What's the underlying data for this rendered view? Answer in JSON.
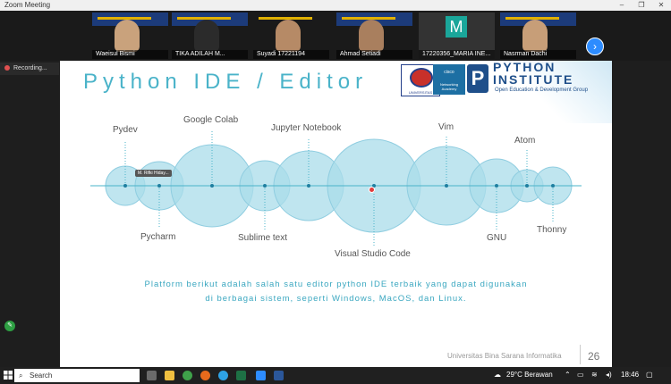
{
  "window": {
    "title": "Zoom Meeting"
  },
  "participants": [
    {
      "name": "Waeisul Bismi"
    },
    {
      "name": "TIKA ADILAH M..."
    },
    {
      "name": "Suyadi 17221194"
    },
    {
      "name": "Ahmad Setiadi"
    },
    {
      "name": "17220356_MARIA INE...",
      "avatar_letter": "M"
    },
    {
      "name": "Nasrman Dachi"
    }
  ],
  "recording": {
    "label": "Recording..."
  },
  "slide": {
    "title": "Python IDE / Editor",
    "logo_univ": "UNIVERSITAS",
    "logo_cisco": "cisco",
    "logo_academy": "Networking Academy",
    "python_institute_letter": "P",
    "python_institute_name_line1": "PYTHON",
    "python_institute_name_line2": "INSTITUTE",
    "python_institute_sub": "Open Education & Development Group",
    "ide_labels": {
      "pydev": "Pydev",
      "pycharm": "Pycharm",
      "colab": "Google Colab",
      "sublime": "Sublime text",
      "jupyter": "Jupyter Notebook",
      "vscode": "Visual Studio Code",
      "vim": "Vim",
      "gnu": "GNU",
      "atom": "Atom",
      "thonny": "Thonny"
    },
    "tooltip": "M. Rifki Hiday...",
    "caption_line1": "Platform berikut adalah salah satu editor python IDE terbaik yang dapat digunakan",
    "caption_line2": "di berbagai sistem, seperti Windows, MacOS, dan Linux.",
    "footer": "Universitas Bina Sarana Informatika",
    "page_number": "26"
  },
  "taskbar": {
    "search_placeholder": "Search",
    "weather": "29°C  Berawan",
    "time": "18:46"
  },
  "colors": {
    "accent": "#4ab3c9",
    "bubble": "#a9dcea",
    "zoom_blue": "#2d8cff"
  }
}
